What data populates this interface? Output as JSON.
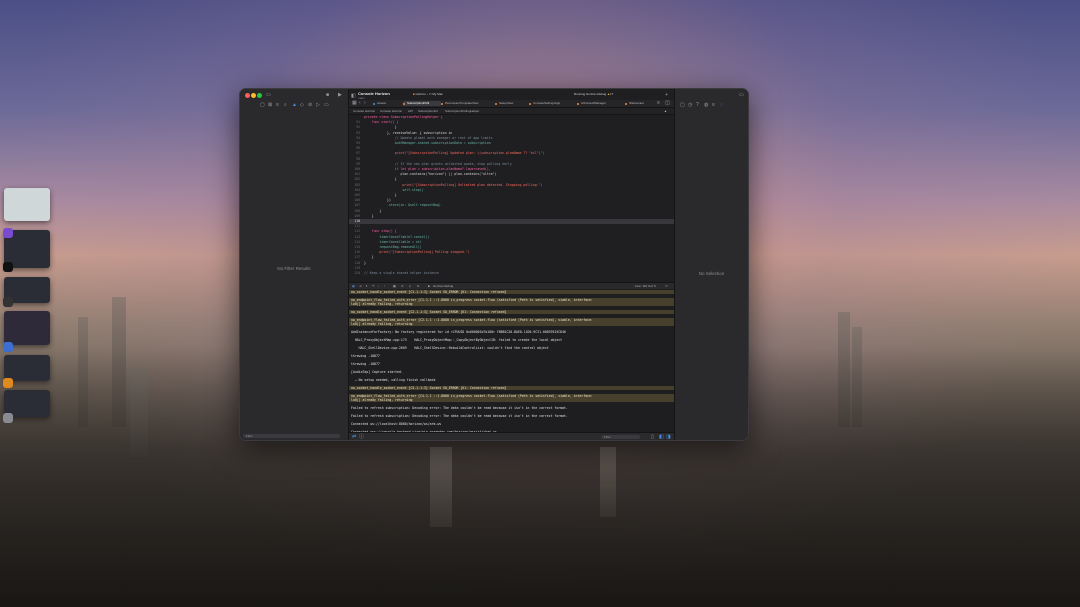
{
  "colors": {
    "accent": "#4a90e2",
    "warning_row": "#47402c",
    "close": "#ff5f57",
    "minimize": "#febc2e",
    "zoom": "#28c840"
  },
  "window": {
    "project_title": "Console Horizon",
    "project_subtitle": "main",
    "scheme_target": "Horizon",
    "scheme_device": "My Mac",
    "status_text": "Running Horizon-Debug",
    "warning_count": "17"
  },
  "tabs": [
    {
      "label": "Assets"
    },
    {
      "label": "SubscriptionPolli"
    },
    {
      "label": "PermissionTemplateView"
    },
    {
      "label": "SetupView"
    },
    {
      "label": "ConsoleSettingsApp"
    },
    {
      "label": "AIContextManager"
    },
    {
      "label": "Websocket"
    }
  ],
  "breadcrumbs": [
    "Console Horizon",
    "Console Horizon",
    "API",
    "SubscriptionPo",
    "SubscriptionPollingHelper"
  ],
  "left_pane": {
    "empty_text": "No Filter Results",
    "filter_placeholder": "Filter"
  },
  "right_pane": {
    "empty_text": "No Selection"
  },
  "code_lines": [
    {
      "n": "",
      "text": "private class SubscriptionPollingHelper {"
    },
    {
      "n": "91",
      "text": "    func start() {"
    },
    {
      "n": "92",
      "text": "                }"
    },
    {
      "n": "93",
      "text": "            }, receiveValue: { subscription in"
    },
    {
      "n": "94",
      "text": "                // Update global auth manager or rest of app limits"
    },
    {
      "n": "95",
      "text": "                AuthManager.shared.subscriptionData = subscription"
    },
    {
      "n": "96",
      "text": ""
    },
    {
      "n": "97",
      "text": "                print(\"[SubscriptionPolling] Updated plan: \\(subscription.planName ?? \"nil\")\")"
    },
    {
      "n": "98",
      "text": ""
    },
    {
      "n": "99",
      "text": "                // If the new plan grants unlimited quota, stop polling early"
    },
    {
      "n": "100",
      "text": "                if let plan = subscription.planName?.lowercased(),"
    },
    {
      "n": "101",
      "text": "                   plan.contains(\"horizon\") || plan.contains(\"ultra\")"
    },
    {
      "n": "102",
      "text": "                {"
    },
    {
      "n": "103",
      "text": "                    print(\"[SubscriptionPolling] Unlimited plan detected. Stopping polling.\")"
    },
    {
      "n": "104",
      "text": "                    self.stop()"
    },
    {
      "n": "105",
      "text": "                }"
    },
    {
      "n": "106",
      "text": "            })"
    },
    {
      "n": "107",
      "text": "            .store(in: &self.requestBag)"
    },
    {
      "n": "108",
      "text": "        }"
    },
    {
      "n": "109",
      "text": "    }"
    },
    {
      "n": "110",
      "text": "",
      "current": true
    },
    {
      "n": "111",
      "text": ""
    },
    {
      "n": "112",
      "text": "    func stop() {"
    },
    {
      "n": "113",
      "text": "        timerCancellable?.cancel()"
    },
    {
      "n": "114",
      "text": "        timerCancellable = nil"
    },
    {
      "n": "115",
      "text": "        requestBag.removeAll()"
    },
    {
      "n": "116",
      "text": "        print(\"[SubscriptionPolling] Polling stopped.\")"
    },
    {
      "n": "117",
      "text": "    }"
    },
    {
      "n": "118",
      "text": "}"
    },
    {
      "n": "119",
      "text": ""
    },
    {
      "n": "120",
      "text": "// Keep a single shared helper instance"
    }
  ],
  "debug_bar": {
    "process": "Horizon-Debug",
    "position": "Line: 110  Col: 5"
  },
  "console_lines": [
    {
      "text": "nw_socket_handle_socket_event [C1.1.1:3] Socket SO_ERROR [61: Connection refused]",
      "warn": true
    },
    {
      "text": "nw_endpoint_flow_failed_with_error [C1.1.1 ::1.8080 in_progress socket-flow (satisfied (Path is satisfied), viable, interface:\nlo0)] already failing, returning",
      "warn": true
    },
    {
      "text": "nw_socket_handle_socket_event [C2.1.1:3] Socket SO_ERROR [61: Connection refused]",
      "warn": true
    },
    {
      "text": "nw_endpoint_flow_failed_with_error [C2.1.1 ::1.8080 in_progress socket-flow (satisfied (Path is satisfied), viable, interface:\nlo0)] already failing, returning",
      "warn": true
    },
    {
      "text": "AddInstanceForFactory: No factory registered for id <CFUUID 0x600001b7b180> F8BB1C28-BAE8-11D6-9C31-00039315CD46",
      "warn": false
    },
    {
      "text": "  HALC_ProxyObjectMap.cpp:173    HALC_ProxyObjectMap::_CopyObjectByObjectID: failed to create the local object",
      "warn": false
    },
    {
      "text": "    HALC_ShellDevice.cpp:2669    HALC_ShellDevice::RebuildControlList: couldn't find the control object",
      "warn": false
    },
    {
      "text": "throwing -10877",
      "warn": false
    },
    {
      "text": "throwing -10877",
      "warn": false
    },
    {
      "text": "[AudioTap] Capture started.",
      "warn": false
    },
    {
      "text": "  → No setup needed, calling finish callback",
      "warn": false
    },
    {
      "text": "nw_socket_handle_socket_event [C4.1.1:3] Socket SO_ERROR [61: Connection refused]",
      "warn": true
    },
    {
      "text": "nw_endpoint_flow_failed_with_error [C4.1.1 ::1.8080 in_progress socket-flow (satisfied (Path is satisfied), viable, interface:\nlo0)] already failing, returning",
      "warn": true
    },
    {
      "text": "Failed to refresh subscription: Decoding error: The data couldn't be read because it isn't in the correct format.",
      "warn": false
    },
    {
      "text": "Failed to refresh subscription: Decoding error: The data couldn't be read because it isn't in the correct format.",
      "warn": false
    },
    {
      "text": "Connected ws://localhost:8080/horizon/ws/arb-ws",
      "warn": false
    },
    {
      "text": "Connected wss://console-backend-virginia.onrender.com/horizon/assist/chat-ws",
      "warn": false
    }
  ],
  "console_filter_placeholder": "Filter"
}
